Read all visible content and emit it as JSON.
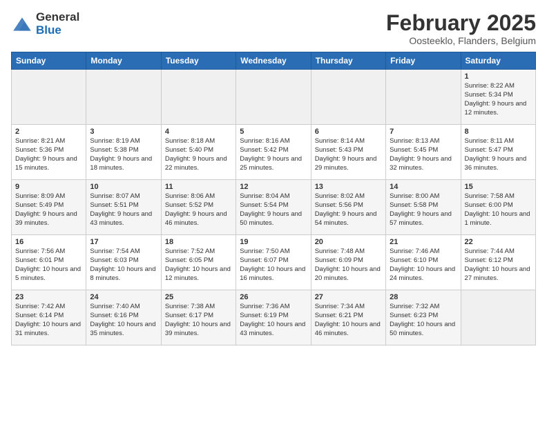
{
  "logo": {
    "general": "General",
    "blue": "Blue"
  },
  "title": "February 2025",
  "subtitle": "Oosteeklo, Flanders, Belgium",
  "weekdays": [
    "Sunday",
    "Monday",
    "Tuesday",
    "Wednesday",
    "Thursday",
    "Friday",
    "Saturday"
  ],
  "weeks": [
    [
      {
        "day": "",
        "info": ""
      },
      {
        "day": "",
        "info": ""
      },
      {
        "day": "",
        "info": ""
      },
      {
        "day": "",
        "info": ""
      },
      {
        "day": "",
        "info": ""
      },
      {
        "day": "",
        "info": ""
      },
      {
        "day": "1",
        "info": "Sunrise: 8:22 AM\nSunset: 5:34 PM\nDaylight: 9 hours and 12 minutes."
      }
    ],
    [
      {
        "day": "2",
        "info": "Sunrise: 8:21 AM\nSunset: 5:36 PM\nDaylight: 9 hours and 15 minutes."
      },
      {
        "day": "3",
        "info": "Sunrise: 8:19 AM\nSunset: 5:38 PM\nDaylight: 9 hours and 18 minutes."
      },
      {
        "day": "4",
        "info": "Sunrise: 8:18 AM\nSunset: 5:40 PM\nDaylight: 9 hours and 22 minutes."
      },
      {
        "day": "5",
        "info": "Sunrise: 8:16 AM\nSunset: 5:42 PM\nDaylight: 9 hours and 25 minutes."
      },
      {
        "day": "6",
        "info": "Sunrise: 8:14 AM\nSunset: 5:43 PM\nDaylight: 9 hours and 29 minutes."
      },
      {
        "day": "7",
        "info": "Sunrise: 8:13 AM\nSunset: 5:45 PM\nDaylight: 9 hours and 32 minutes."
      },
      {
        "day": "8",
        "info": "Sunrise: 8:11 AM\nSunset: 5:47 PM\nDaylight: 9 hours and 36 minutes."
      }
    ],
    [
      {
        "day": "9",
        "info": "Sunrise: 8:09 AM\nSunset: 5:49 PM\nDaylight: 9 hours and 39 minutes."
      },
      {
        "day": "10",
        "info": "Sunrise: 8:07 AM\nSunset: 5:51 PM\nDaylight: 9 hours and 43 minutes."
      },
      {
        "day": "11",
        "info": "Sunrise: 8:06 AM\nSunset: 5:52 PM\nDaylight: 9 hours and 46 minutes."
      },
      {
        "day": "12",
        "info": "Sunrise: 8:04 AM\nSunset: 5:54 PM\nDaylight: 9 hours and 50 minutes."
      },
      {
        "day": "13",
        "info": "Sunrise: 8:02 AM\nSunset: 5:56 PM\nDaylight: 9 hours and 54 minutes."
      },
      {
        "day": "14",
        "info": "Sunrise: 8:00 AM\nSunset: 5:58 PM\nDaylight: 9 hours and 57 minutes."
      },
      {
        "day": "15",
        "info": "Sunrise: 7:58 AM\nSunset: 6:00 PM\nDaylight: 10 hours and 1 minute."
      }
    ],
    [
      {
        "day": "16",
        "info": "Sunrise: 7:56 AM\nSunset: 6:01 PM\nDaylight: 10 hours and 5 minutes."
      },
      {
        "day": "17",
        "info": "Sunrise: 7:54 AM\nSunset: 6:03 PM\nDaylight: 10 hours and 8 minutes."
      },
      {
        "day": "18",
        "info": "Sunrise: 7:52 AM\nSunset: 6:05 PM\nDaylight: 10 hours and 12 minutes."
      },
      {
        "day": "19",
        "info": "Sunrise: 7:50 AM\nSunset: 6:07 PM\nDaylight: 10 hours and 16 minutes."
      },
      {
        "day": "20",
        "info": "Sunrise: 7:48 AM\nSunset: 6:09 PM\nDaylight: 10 hours and 20 minutes."
      },
      {
        "day": "21",
        "info": "Sunrise: 7:46 AM\nSunset: 6:10 PM\nDaylight: 10 hours and 24 minutes."
      },
      {
        "day": "22",
        "info": "Sunrise: 7:44 AM\nSunset: 6:12 PM\nDaylight: 10 hours and 27 minutes."
      }
    ],
    [
      {
        "day": "23",
        "info": "Sunrise: 7:42 AM\nSunset: 6:14 PM\nDaylight: 10 hours and 31 minutes."
      },
      {
        "day": "24",
        "info": "Sunrise: 7:40 AM\nSunset: 6:16 PM\nDaylight: 10 hours and 35 minutes."
      },
      {
        "day": "25",
        "info": "Sunrise: 7:38 AM\nSunset: 6:17 PM\nDaylight: 10 hours and 39 minutes."
      },
      {
        "day": "26",
        "info": "Sunrise: 7:36 AM\nSunset: 6:19 PM\nDaylight: 10 hours and 43 minutes."
      },
      {
        "day": "27",
        "info": "Sunrise: 7:34 AM\nSunset: 6:21 PM\nDaylight: 10 hours and 46 minutes."
      },
      {
        "day": "28",
        "info": "Sunrise: 7:32 AM\nSunset: 6:23 PM\nDaylight: 10 hours and 50 minutes."
      },
      {
        "day": "",
        "info": ""
      }
    ]
  ]
}
